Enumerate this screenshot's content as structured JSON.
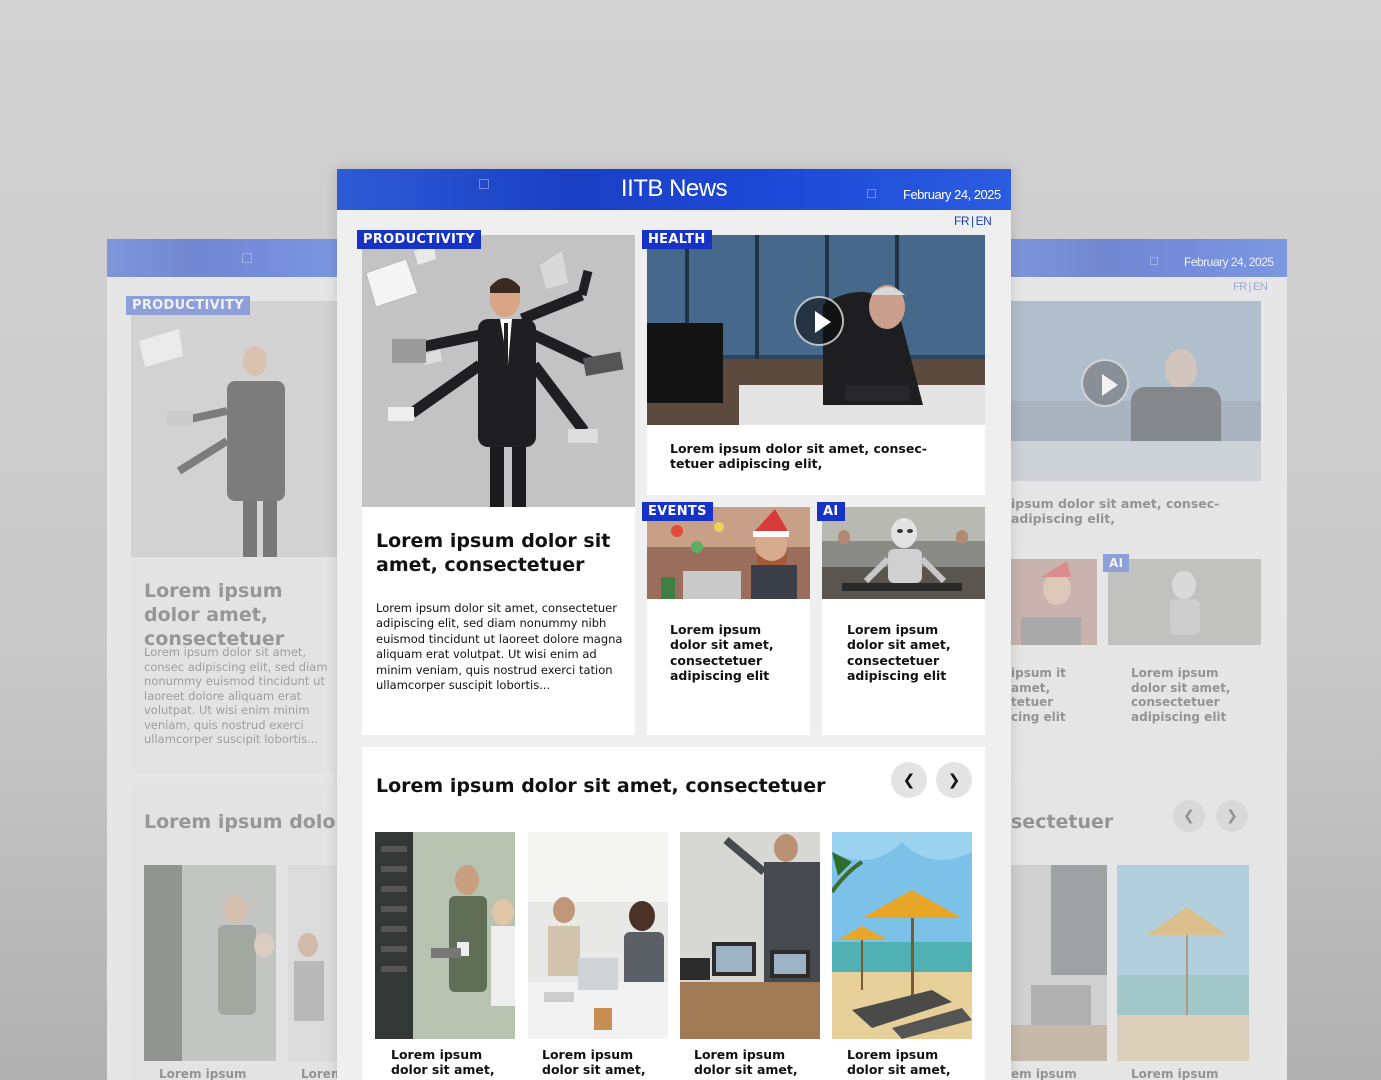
{
  "header": {
    "title": "IITB News",
    "date": "February 24, 2025"
  },
  "lang": {
    "fr": "FR",
    "en": "EN",
    "sep": "|"
  },
  "tags": {
    "productivity": "PRODUCTIVITY",
    "health": "HEALTH",
    "events": "EVENTS",
    "ai": "AI"
  },
  "feature": {
    "headline": "Lorem ipsum dolor sit amet, consectetuer",
    "body": "Lorem ipsum dolor sit amet, consectetuer adipiscing elit, sed diam nonummy nibh euismod tincidunt ut laoreet dolore magna aliquam erat volutpat. Ut wisi enim ad minim veniam, quis nostrud exerci tation ullamcorper suscipit lobortis..."
  },
  "health": {
    "caption": "Lorem ipsum dolor sit amet, consec-tetuer adipiscing elit,"
  },
  "events": {
    "caption": "Lorem ipsum dolor sit amet, consectetuer adipiscing elit"
  },
  "ai": {
    "caption": "Lorem ipsum dolor sit amet, consectetuer adipiscing elit"
  },
  "carousel": {
    "title": "Lorem ipsum dolor sit amet, consectetuer",
    "items": [
      {
        "caption": "Lorem ipsum dolor sit amet,"
      },
      {
        "caption": "Lorem ipsum dolor sit amet,"
      },
      {
        "caption": "Lorem ipsum dolor sit amet,"
      },
      {
        "caption": "Lorem ipsum dolor sit amet,"
      }
    ]
  },
  "left_mock": {
    "tag": "PRODUCTIVITY",
    "headline": "Lorem ipsum dolor amet, consectetuer",
    "body": "Lorem ipsum dolor sit amet, consec adipiscing elit, sed diam nonummy euismod tincidunt ut laoreet dolore aliquam erat volutpat. Ut wisi enim minim veniam, quis nostrud exerci ullamcorper suscipit lobortis...",
    "section_title": "Lorem ipsum dolor",
    "cap1": "Lorem ipsum",
    "cap2": "Lorem"
  },
  "right_mock": {
    "date": "February 24, 2025",
    "health_caption": "ipsum dolor sit amet, consec-adipiscing elit,",
    "left_caption": "ipsum it amet, tetuer cing elit",
    "ai_tag": "AI",
    "ai_caption": "Lorem ipsum dolor sit amet, consectetuer adipiscing elit",
    "section_title": "sectetuer",
    "cap1": "em ipsum",
    "cap2": "Lorem ipsum"
  }
}
